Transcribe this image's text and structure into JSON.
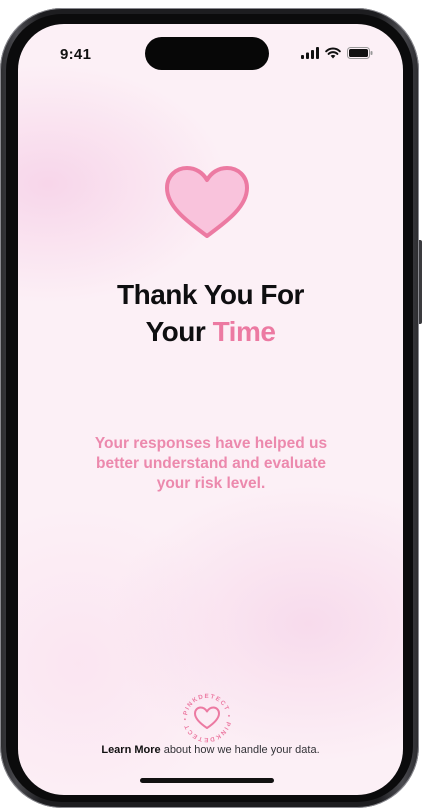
{
  "status_bar": {
    "time": "9:41",
    "icons": [
      "cellular-signal-icon",
      "wifi-icon",
      "battery-icon"
    ]
  },
  "hero": {
    "icon": "heart-icon"
  },
  "title": {
    "line1": "Thank You For",
    "line2_plain": "Your ",
    "line2_accent": "Time"
  },
  "message": {
    "text": "Your responses have helped us better understand and evaluate your risk level."
  },
  "brand": {
    "name": "PINKDETECT",
    "logo_icon": "pinkdetect-logo-icon"
  },
  "footer": {
    "link_label": "Learn More",
    "note": " about how we handle your data."
  },
  "colors": {
    "accent": "#ec7aa2",
    "message_text": "#ec89ad",
    "background": "#fcf0f6",
    "heart_fill": "#f9c3dc",
    "heart_stroke": "#ec7aa2"
  }
}
